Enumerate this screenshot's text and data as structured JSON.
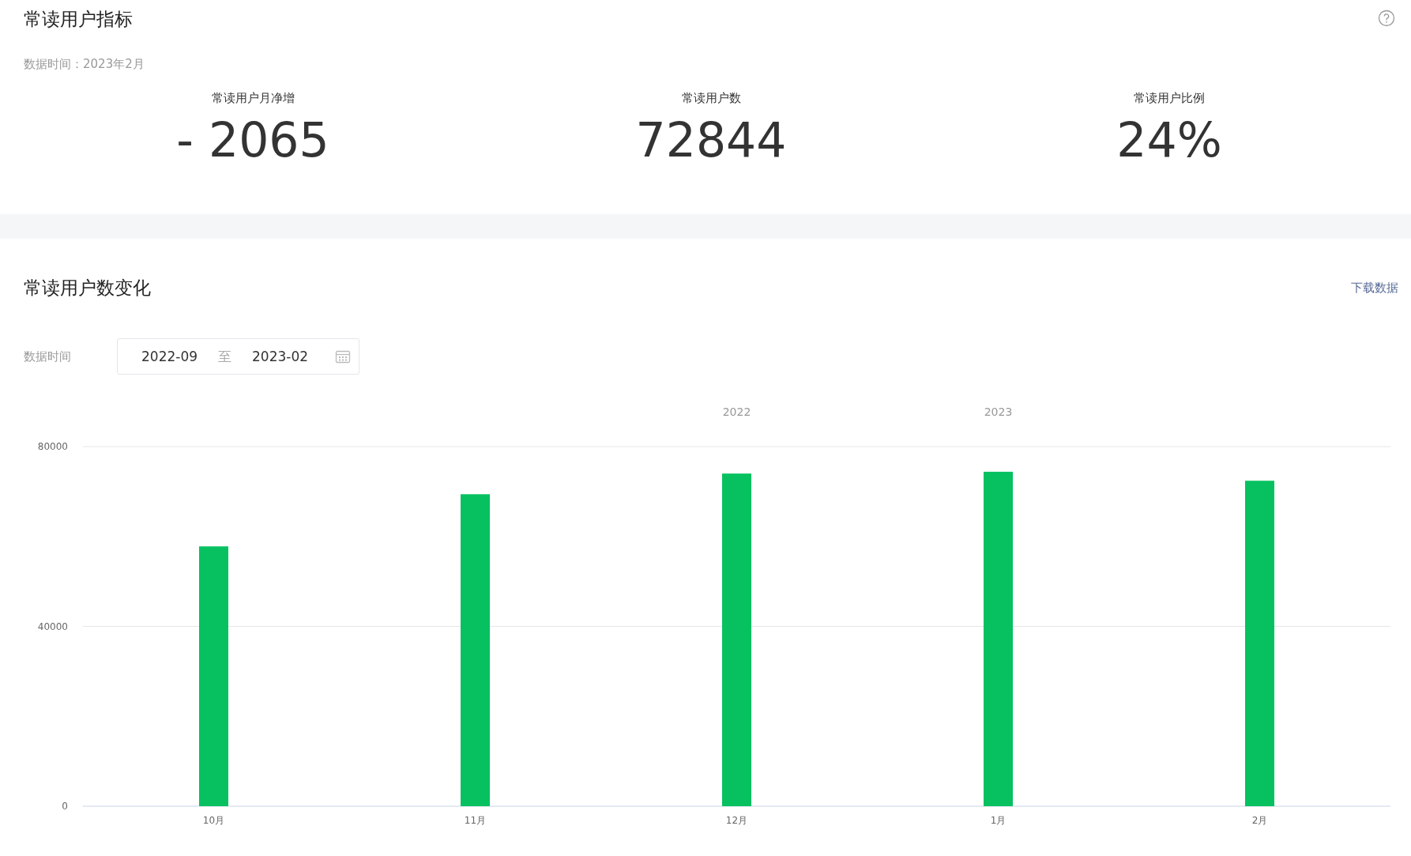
{
  "overview": {
    "title": "常读用户指标",
    "data_time": "数据时间：2023年2月",
    "metrics": [
      {
        "label": "常读用户月净增",
        "value": "- 2065"
      },
      {
        "label": "常读用户数",
        "value": "72844"
      },
      {
        "label": "常读用户比例",
        "value": "24%"
      }
    ]
  },
  "trend": {
    "title": "常读用户数变化",
    "download_link": "下载数据",
    "range_label": "数据时间",
    "range_start": "2022-09",
    "range_separator": "至",
    "range_end": "2023-02",
    "chart_data": {
      "type": "bar",
      "categories": [
        "10月",
        "11月",
        "12月",
        "1月",
        "2月"
      ],
      "series": [
        {
          "color": "#07c160",
          "values": [
            57800,
            69400,
            74000,
            74400,
            72400
          ]
        }
      ],
      "ylim": [
        0,
        80000
      ],
      "yticks": [
        0,
        40000,
        80000
      ],
      "annotations": [
        "2022",
        "2023"
      ]
    }
  }
}
